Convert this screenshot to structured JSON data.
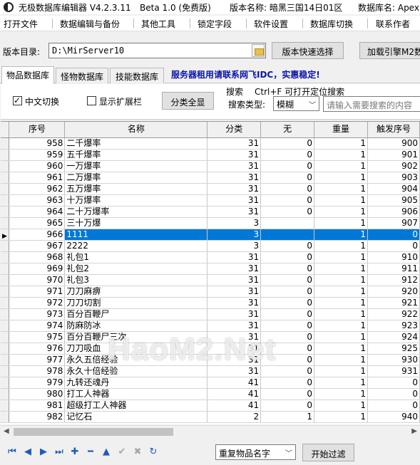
{
  "window": {
    "title": "无极数据库编辑器 V4.2.3.11",
    "edition": "Beta 1.0 (免费版)",
    "version_name": "版本名称: 暗黑三国14日01区",
    "db_name": "数据库名: Apex"
  },
  "menu": [
    "打开文件",
    "数据编辑与备份",
    "其他工具",
    "锁定字段",
    "软件设置",
    "数据库切换",
    "联系作者"
  ],
  "dir": {
    "label": "版本目录:",
    "value": "D:\\MirServer10",
    "quick_select": "版本快速选择",
    "load_engine": "加载引擎M2数"
  },
  "tabs": [
    "物品数据库",
    "怪物数据库",
    "技能数据库"
  ],
  "ad_text": "服务器租用请联系网飞IDC，实惠稳定!",
  "tools": {
    "chinese_switch": "中文切换",
    "show_ext": "显示扩展栏",
    "show_all": "分类全显",
    "search_label": "搜索",
    "search_hint": "Ctrl+F 可打开定位搜索",
    "search_type_label": "搜索类型:",
    "search_type_value": "模糊",
    "search_placeholder": "请输入需要搜索的内容"
  },
  "columns": [
    "序号",
    "名称",
    "分类",
    "无",
    "重量",
    "触发序号"
  ],
  "rows": [
    [
      "958",
      "二千爆率",
      "31",
      "0",
      "1",
      "900"
    ],
    [
      "959",
      "五千爆率",
      "31",
      "0",
      "1",
      "901"
    ],
    [
      "960",
      "一万爆率",
      "31",
      "0",
      "1",
      "902"
    ],
    [
      "961",
      "二万爆率",
      "31",
      "0",
      "1",
      "903"
    ],
    [
      "962",
      "五万爆率",
      "31",
      "0",
      "1",
      "904"
    ],
    [
      "963",
      "十万爆率",
      "31",
      "0",
      "1",
      "905"
    ],
    [
      "964",
      "二十万爆率",
      "31",
      "0",
      "1",
      "906"
    ],
    [
      "965",
      "三十万爆",
      "3",
      "",
      "1",
      "907"
    ],
    [
      "966",
      "1111",
      "3",
      "",
      "1",
      "0"
    ],
    [
      "967",
      "2222",
      "3",
      "0",
      "1",
      "0"
    ],
    [
      "968",
      "礼包1",
      "31",
      "0",
      "1",
      "910"
    ],
    [
      "969",
      "礼包2",
      "31",
      "0",
      "1",
      "911"
    ],
    [
      "970",
      "礼包3",
      "31",
      "0",
      "1",
      "912"
    ],
    [
      "971",
      "刀刀麻痹",
      "31",
      "0",
      "1",
      "920"
    ],
    [
      "972",
      "刀刀切割",
      "31",
      "0",
      "1",
      "921"
    ],
    [
      "973",
      "百分百鞭尸",
      "31",
      "0",
      "1",
      "922"
    ],
    [
      "974",
      "防麻防冰",
      "31",
      "0",
      "1",
      "923"
    ],
    [
      "975",
      "百分百鞭尸三次",
      "31",
      "0",
      "1",
      "924"
    ],
    [
      "976",
      "刀刀吸血",
      "31",
      "0",
      "1",
      "925"
    ],
    [
      "977",
      "永久五倍经验",
      "31",
      "0",
      "1",
      "930"
    ],
    [
      "978",
      "永久十倍经验",
      "31",
      "0",
      "1",
      "931"
    ],
    [
      "979",
      "九转还魂丹",
      "41",
      "0",
      "1",
      "0"
    ],
    [
      "980",
      "打工人神器",
      "41",
      "0",
      "1",
      "0"
    ],
    [
      "981",
      "超级打工人神器",
      "41",
      "0",
      "1",
      "0"
    ],
    [
      "982",
      "记忆石",
      "2",
      "1",
      "1",
      "940"
    ]
  ],
  "selected_row_index": 8,
  "watermark": "HaoM2.Net",
  "nav_icons": [
    "first-icon",
    "prior-icon",
    "next-icon",
    "last-icon",
    "insert-icon",
    "delete-icon",
    "edit-icon",
    "post-icon",
    "cancel-icon",
    "refresh-icon"
  ],
  "filter": {
    "select_value": "重复物品名字",
    "start_button": "开始过滤"
  }
}
